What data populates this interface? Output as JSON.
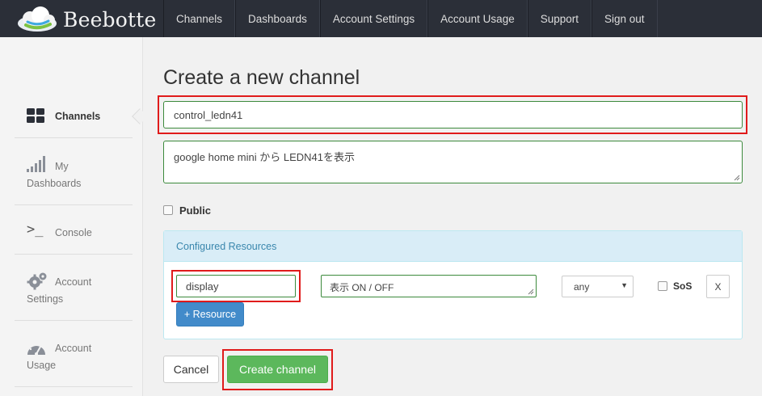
{
  "header": {
    "brand": "Beebotte",
    "nav": [
      "Channels",
      "Dashboards",
      "Account Settings",
      "Account Usage",
      "Support",
      "Sign out"
    ]
  },
  "sidebar": {
    "items": [
      {
        "label": "Channels",
        "icon": "grid-icon"
      },
      {
        "label1": "My",
        "label2": "Dashboards",
        "icon": "signal-bars-icon"
      },
      {
        "label": "Console",
        "icon": "terminal-icon"
      },
      {
        "label1": "Account",
        "label2": "Settings",
        "icon": "gears-icon"
      },
      {
        "label1": "Account",
        "label2": "Usage",
        "icon": "speedometer-icon"
      }
    ]
  },
  "main": {
    "title": "Create a new channel",
    "channel_name": "control_ledn41",
    "description": "google home mini から LEDN41を表示",
    "public_label": "Public",
    "public_checked": false
  },
  "resources": {
    "panel_title": "Configured Resources",
    "rows": [
      {
        "name": "display",
        "description": "表示 ON / OFF",
        "type": "any",
        "sos_label": "SoS",
        "sos_checked": false,
        "remove_label": "X"
      }
    ],
    "add_label": "+ Resource"
  },
  "actions": {
    "cancel": "Cancel",
    "create": "Create channel"
  },
  "colors": {
    "topbar": "#2b2f38",
    "highlight": "#e01b1b",
    "primary": "#428bca",
    "success": "#5cb85c",
    "panel_head": "#d9edf7",
    "valid_border": "#3c8a3c"
  }
}
